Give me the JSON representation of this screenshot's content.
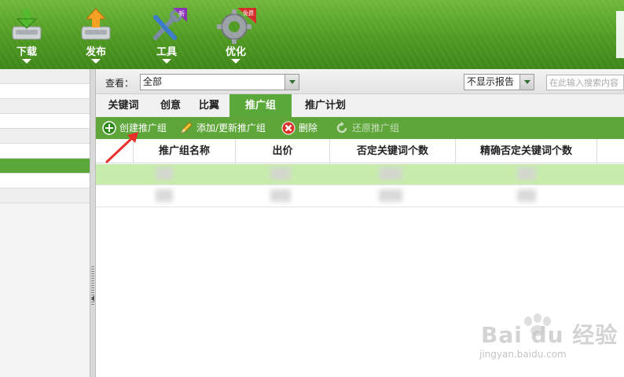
{
  "header": {
    "tools": [
      {
        "label": "下载",
        "icon": "download-icon"
      },
      {
        "label": "发布",
        "icon": "publish-icon"
      },
      {
        "label": "工具",
        "icon": "tools-icon",
        "badge": "新"
      },
      {
        "label": "优化",
        "icon": "optimize-icon",
        "badge": "免费"
      }
    ]
  },
  "filter": {
    "view_label": "查看：",
    "view_value": "全部",
    "report_value": "不显示报告",
    "search_placeholder": "在此输入搜索内容"
  },
  "tabs": [
    "关键词",
    "创意",
    "比翼",
    "推广组",
    "推广计划"
  ],
  "active_tab": "推广组",
  "actions": [
    {
      "label": "创建推广组",
      "icon": "add-circle-icon",
      "enabled": true
    },
    {
      "label": "添加/更新推广组",
      "icon": "pencil-icon",
      "enabled": true
    },
    {
      "label": "删除",
      "icon": "delete-icon",
      "enabled": true
    },
    {
      "label": "还原推广组",
      "icon": "restore-icon",
      "enabled": false
    }
  ],
  "grid": {
    "columns": [
      "推广组名称",
      "出价",
      "否定关键词个数",
      "精确否定关键词个数"
    ]
  },
  "watermark": {
    "text": "Bai du 经验",
    "sub": "jingyan.baidu.com"
  },
  "colors": {
    "header_green": "#4f9a22",
    "accent_green": "#5aa83a",
    "selected_row": "#c8ecac"
  }
}
